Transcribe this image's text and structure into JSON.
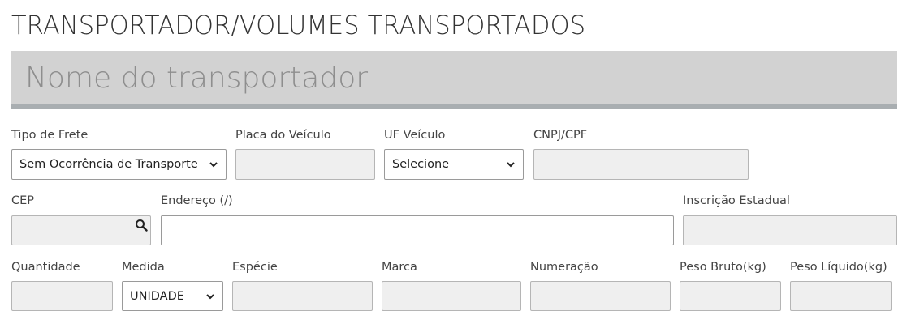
{
  "section": {
    "title": "TRANSPORTADOR/VOLUMES TRANSPORTADOS"
  },
  "carrier": {
    "placeholder": "Nome do transportador",
    "value": ""
  },
  "row1": {
    "tipo_frete": {
      "label": "Tipo de Frete",
      "value": "Sem Ocorrência de Transporte"
    },
    "placa": {
      "label": "Placa do Veículo",
      "value": ""
    },
    "uf": {
      "label": "UF Veículo",
      "value": "Selecione"
    },
    "cnpj": {
      "label": "CNPJ/CPF",
      "value": ""
    }
  },
  "row2": {
    "cep": {
      "label": "CEP",
      "value": ""
    },
    "endereco": {
      "label": "Endereço (/)",
      "value": ""
    },
    "ie": {
      "label": "Inscrição Estadual",
      "value": ""
    }
  },
  "row3": {
    "quantidade": {
      "label": "Quantidade",
      "value": ""
    },
    "medida": {
      "label": "Medida",
      "value": "UNIDADE"
    },
    "especie": {
      "label": "Espécie",
      "value": ""
    },
    "marca": {
      "label": "Marca",
      "value": ""
    },
    "numeracao": {
      "label": "Numeração",
      "value": ""
    },
    "peso_bruto": {
      "label": "Peso Bruto(kg)",
      "value": ""
    },
    "peso_liquido": {
      "label": "Peso Líquido(kg)",
      "value": ""
    }
  },
  "icons": {
    "search": "search-icon",
    "dropdown": "chevron-down-icon"
  }
}
